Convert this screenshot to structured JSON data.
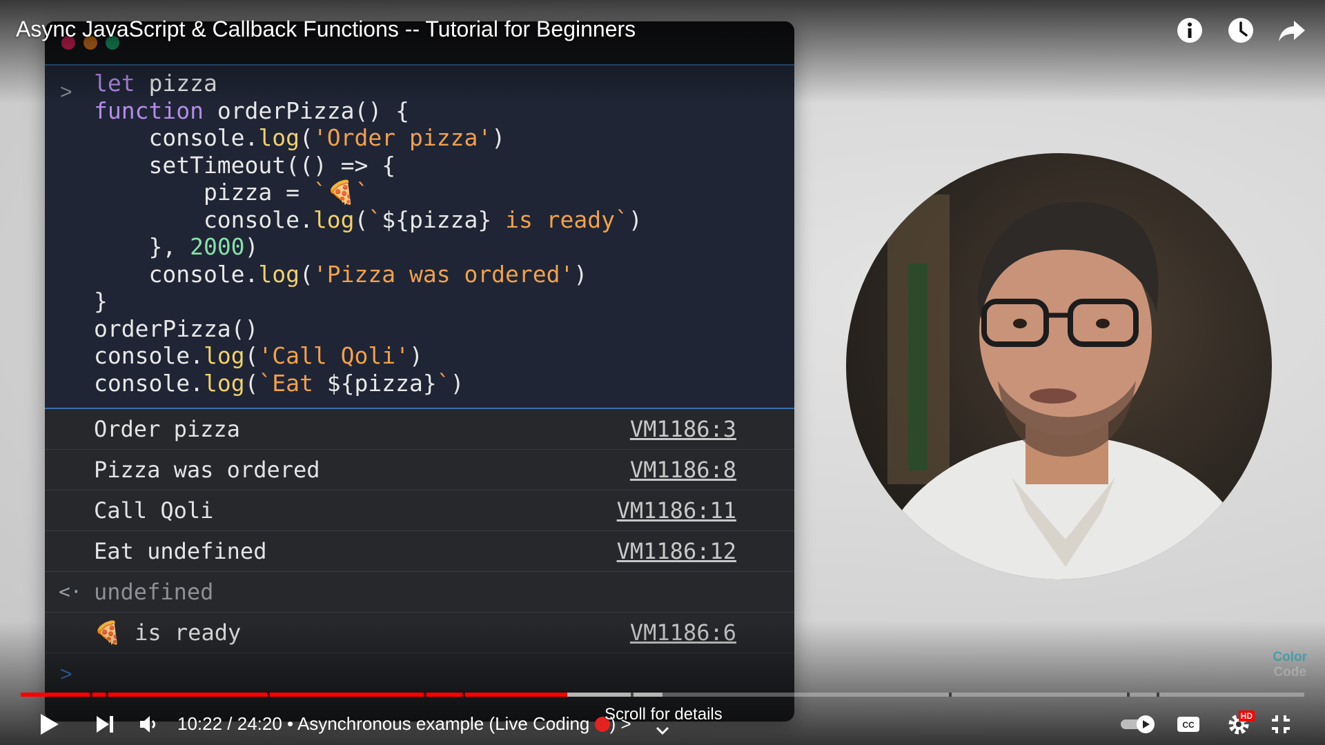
{
  "video": {
    "title": "Async JavaScript & Callback Functions -- Tutorial for Beginners"
  },
  "top_actions": [
    {
      "name": "info-button",
      "icon": "info-icon"
    },
    {
      "name": "watch-later-button",
      "icon": "clock-icon"
    },
    {
      "name": "share-button",
      "icon": "share-arrow-icon"
    }
  ],
  "editor": {
    "window_dots": [
      "#e0245e",
      "#e07a1a",
      "#1aa36b"
    ],
    "code_prompt": ">",
    "code_lines": [
      [
        [
          "kw",
          "let"
        ],
        [
          "plain",
          " pizza"
        ]
      ],
      [
        [
          "kw",
          "function"
        ],
        [
          "plain",
          " orderPizza() {"
        ]
      ],
      [
        [
          "plain",
          "    console."
        ],
        [
          "fn",
          "log"
        ],
        [
          "plain",
          "("
        ],
        [
          "str",
          "'Order pizza'"
        ],
        [
          "plain",
          ")"
        ]
      ],
      [
        [
          "plain",
          "    setTimeout(() => {"
        ]
      ],
      [
        [
          "plain",
          "        pizza = "
        ],
        [
          "str",
          "`🍕`"
        ]
      ],
      [
        [
          "plain",
          "        console."
        ],
        [
          "fn",
          "log"
        ],
        [
          "plain",
          "("
        ],
        [
          "str",
          "`"
        ],
        [
          "plain",
          "${pizza}"
        ],
        [
          "str",
          " is ready`"
        ],
        [
          "plain",
          ")"
        ]
      ],
      [
        [
          "plain",
          "    }, "
        ],
        [
          "num",
          "2000"
        ],
        [
          "plain",
          ")"
        ]
      ],
      [
        [
          "plain",
          "    console."
        ],
        [
          "fn",
          "log"
        ],
        [
          "plain",
          "("
        ],
        [
          "str",
          "'Pizza was ordered'"
        ],
        [
          "plain",
          ")"
        ]
      ],
      [
        [
          "plain",
          "}"
        ]
      ],
      [
        [
          "plain",
          "orderPizza()"
        ]
      ],
      [
        [
          "plain",
          "console."
        ],
        [
          "fn",
          "log"
        ],
        [
          "plain",
          "("
        ],
        [
          "str",
          "'Call Qoli'"
        ],
        [
          "plain",
          ")"
        ]
      ],
      [
        [
          "plain",
          "console."
        ],
        [
          "fn",
          "log"
        ],
        [
          "plain",
          "("
        ],
        [
          "str",
          "`Eat "
        ],
        [
          "plain",
          "${pizza}"
        ],
        [
          "str",
          "`"
        ],
        [
          "plain",
          ")"
        ]
      ]
    ],
    "console": [
      {
        "message": "Order pizza",
        "source": "VM1186:3"
      },
      {
        "message": "Pizza was ordered",
        "source": "VM1186:8"
      },
      {
        "message": "Call Qoli",
        "source": "VM1186:11"
      },
      {
        "message": "Eat undefined",
        "source": "VM1186:12"
      },
      {
        "message": "undefined",
        "source": "",
        "return_value": true,
        "arrow": "<·"
      },
      {
        "message": "🍕 is ready",
        "source": "VM1186:6"
      }
    ],
    "input_prompt": ">"
  },
  "channel_logo": {
    "line1": "Color",
    "line2": "Code"
  },
  "player": {
    "time": "10:22 / 24:20",
    "chapter": "• Asynchronous example (Live Coding",
    "chapter_suffix": ")",
    "chevron": ">",
    "scroll_hint": "Scroll for details",
    "progress_played": 0.426,
    "progress_buffered": 0.5,
    "hd_badge": "HD",
    "autoplay_on": true,
    "colors": {
      "played": "#ff0000",
      "accent": "#ff0000"
    }
  }
}
